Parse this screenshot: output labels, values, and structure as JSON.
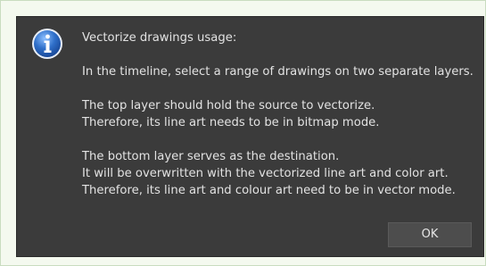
{
  "dialog": {
    "icon": "info-icon",
    "lines": [
      "Vectorize drawings usage:",
      "In the timeline, select a range of drawings on two separate layers.",
      "The top layer should hold the source to vectorize.",
      "Therefore, its line art needs to be in bitmap mode.",
      "The bottom layer serves as the destination.",
      "It will be overwritten with the vectorized line art and color art.",
      "Therefore, its line art and colour art need to be in vector mode."
    ],
    "ok_label": "OK"
  },
  "colors": {
    "dialog_bg": "#3b3b3b",
    "text": "#e2e2e2",
    "icon_blue": "#2f6fc9",
    "outer_bg": "#f4f9ef"
  }
}
